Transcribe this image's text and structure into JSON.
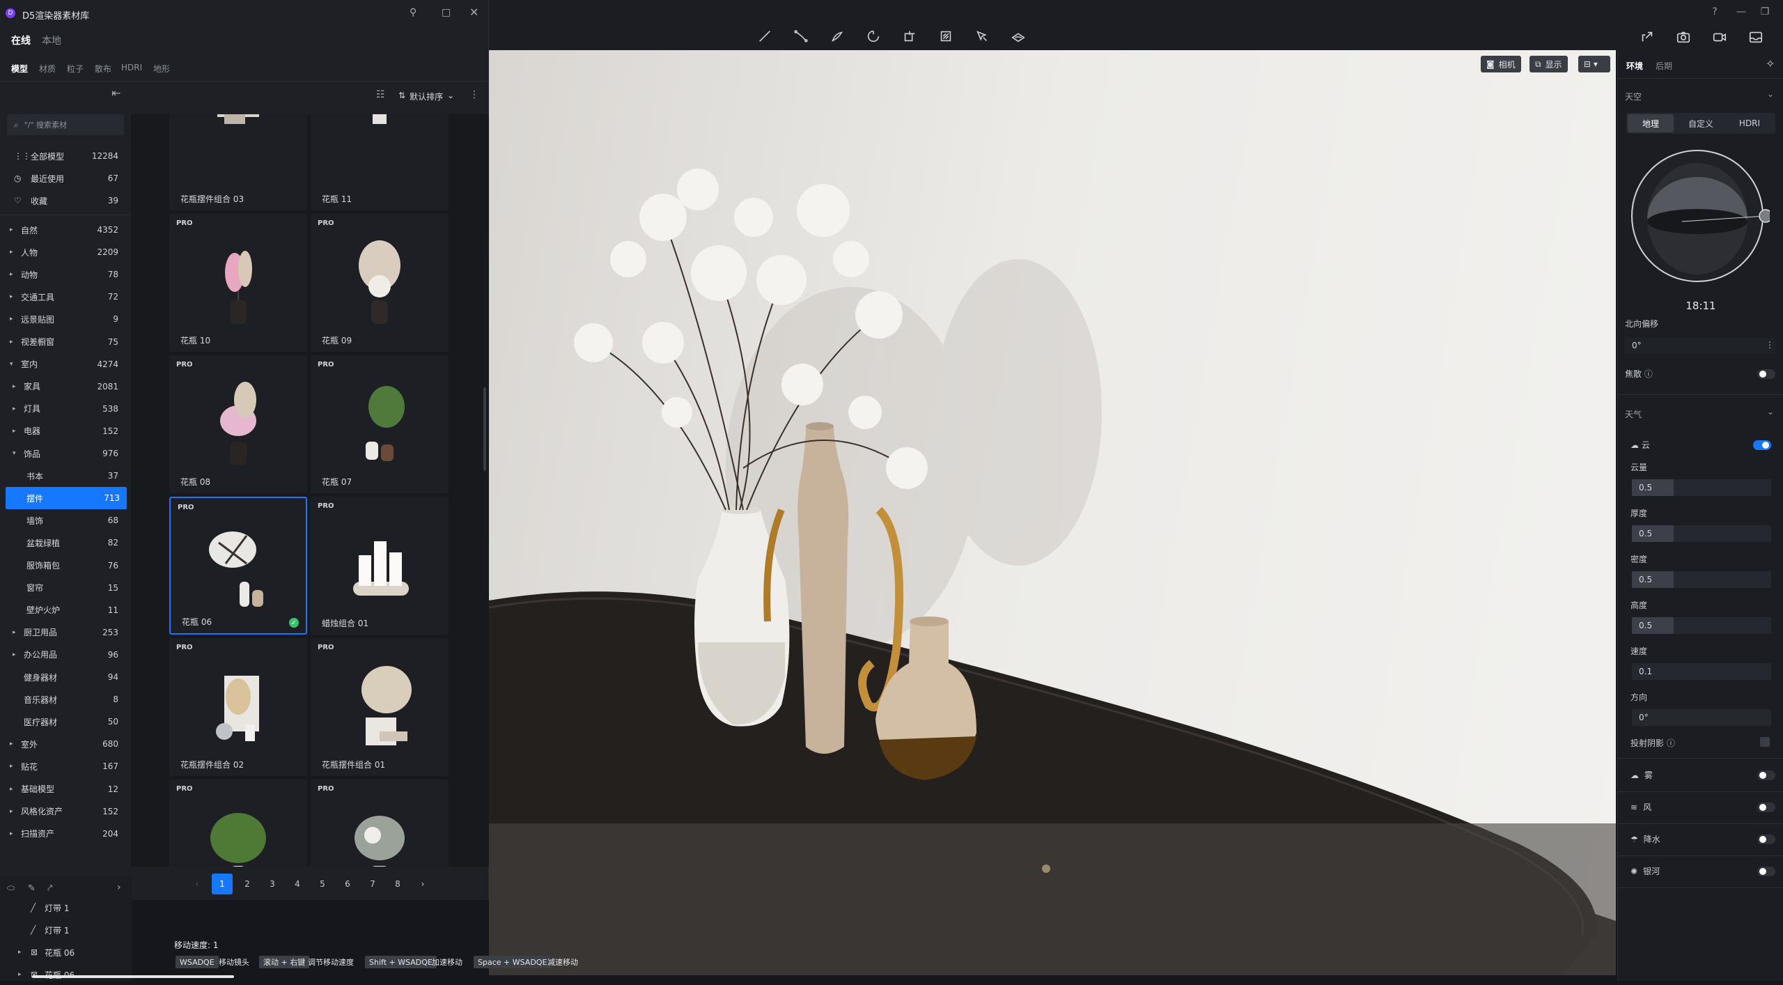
{
  "library": {
    "title": "D5渲染器素材库",
    "source_tabs": [
      "在线",
      "本地"
    ],
    "type_tabs": [
      "模型",
      "材质",
      "粒子",
      "散布",
      "HDRI",
      "地形"
    ],
    "search_placeholder": "\"/\" 搜索素材",
    "sort_label": "默认排序",
    "quick": [
      {
        "label": "全部模型",
        "count": "12284",
        "icon": "grid-icon"
      },
      {
        "label": "最近使用",
        "count": "67",
        "icon": "clock-icon"
      },
      {
        "label": "收藏",
        "count": "39",
        "icon": "heart-icon"
      }
    ],
    "categories": [
      {
        "label": "自然",
        "count": "4352",
        "arrow": "▸",
        "level": 0
      },
      {
        "label": "人物",
        "count": "2209",
        "arrow": "▸",
        "level": 0
      },
      {
        "label": "动物",
        "count": "78",
        "arrow": "▸",
        "level": 0
      },
      {
        "label": "交通工具",
        "count": "72",
        "arrow": "▸",
        "level": 0
      },
      {
        "label": "远景贴图",
        "count": "9",
        "arrow": "▸",
        "level": 0
      },
      {
        "label": "视差橱窗",
        "count": "75",
        "arrow": "▸",
        "level": 0
      },
      {
        "label": "室内",
        "count": "4274",
        "arrow": "▾",
        "level": 0
      },
      {
        "label": "家具",
        "count": "2081",
        "arrow": "▸",
        "level": 1
      },
      {
        "label": "灯具",
        "count": "538",
        "arrow": "▸",
        "level": 1
      },
      {
        "label": "电器",
        "count": "152",
        "arrow": "▸",
        "level": 1
      },
      {
        "label": "饰品",
        "count": "976",
        "arrow": "▾",
        "level": 1
      },
      {
        "label": "书本",
        "count": "37",
        "arrow": "",
        "level": 2
      },
      {
        "label": "摆件",
        "count": "713",
        "arrow": "",
        "level": 2,
        "selected": true
      },
      {
        "label": "墙饰",
        "count": "68",
        "arrow": "",
        "level": 2
      },
      {
        "label": "盆栽绿植",
        "count": "82",
        "arrow": "",
        "level": 2
      },
      {
        "label": "服饰箱包",
        "count": "76",
        "arrow": "",
        "level": 2
      },
      {
        "label": "窗帘",
        "count": "15",
        "arrow": "",
        "level": 2
      },
      {
        "label": "壁炉火炉",
        "count": "11",
        "arrow": "",
        "level": 2
      },
      {
        "label": "厨卫用品",
        "count": "253",
        "arrow": "▸",
        "level": 1
      },
      {
        "label": "办公用品",
        "count": "96",
        "arrow": "▸",
        "level": 1
      },
      {
        "label": "健身器材",
        "count": "94",
        "arrow": "",
        "level": 1
      },
      {
        "label": "音乐器材",
        "count": "8",
        "arrow": "",
        "level": 1
      },
      {
        "label": "医疗器材",
        "count": "50",
        "arrow": "",
        "level": 1
      },
      {
        "label": "室外",
        "count": "680",
        "arrow": "▸",
        "level": 0
      },
      {
        "label": "贴花",
        "count": "167",
        "arrow": "▸",
        "level": 0
      },
      {
        "label": "基础模型",
        "count": "12",
        "arrow": "▸",
        "level": 0
      },
      {
        "label": "风格化资产",
        "count": "152",
        "arrow": "▸",
        "level": 0
      },
      {
        "label": "扫描资产",
        "count": "204",
        "arrow": "▸",
        "level": 0
      }
    ],
    "assets": [
      {
        "name": "花瓶摆件组合 03",
        "pro": "",
        "selected": false
      },
      {
        "name": "花瓶 11",
        "pro": "",
        "selected": false
      },
      {
        "name": "花瓶 10",
        "pro": "PRO",
        "selected": false
      },
      {
        "name": "花瓶 09",
        "pro": "PRO",
        "selected": false
      },
      {
        "name": "花瓶 08",
        "pro": "PRO",
        "selected": false
      },
      {
        "name": "花瓶 07",
        "pro": "PRO",
        "selected": false
      },
      {
        "name": "花瓶 06",
        "pro": "PRO",
        "selected": true
      },
      {
        "name": "蜡烛组合 01",
        "pro": "PRO",
        "selected": false
      },
      {
        "name": "花瓶摆件组合 02",
        "pro": "PRO",
        "selected": false
      },
      {
        "name": "花瓶摆件组合 01",
        "pro": "PRO",
        "selected": false
      },
      {
        "name": "",
        "pro": "PRO",
        "selected": false
      },
      {
        "name": "",
        "pro": "PRO",
        "selected": false
      }
    ],
    "pagination": {
      "prev": "‹",
      "next": "›",
      "pages": [
        "1",
        "2",
        "3",
        "4",
        "5",
        "6",
        "7",
        "8"
      ],
      "current": "1"
    }
  },
  "scene_tree": [
    {
      "label": "灯带 1",
      "icon": "line-icon"
    },
    {
      "label": "灯带 1",
      "icon": "line-icon"
    },
    {
      "label": "花瓶 06",
      "icon": "model-icon"
    },
    {
      "label": "花瓶 06",
      "icon": "model-icon"
    }
  ],
  "viewport": {
    "buttons": [
      "相机",
      "显示"
    ],
    "move_speed": "移动速度: 1",
    "hints": [
      {
        "key": "WSADQE",
        "desc": "移动镜头"
      },
      {
        "key": "滚动 + 右键",
        "desc": "调节移动速度"
      },
      {
        "key": "Shift + WSADQE",
        "desc": "加速移动"
      },
      {
        "key": "Space + WSADQE",
        "desc": "减速移动"
      }
    ]
  },
  "right_panel": {
    "tabs": [
      "环境",
      "后期"
    ],
    "sky_section": "天空",
    "sky_modes": [
      "地理",
      "自定义",
      "HDRI"
    ],
    "time": "18:11",
    "north_offset_label": "北向偏移",
    "north_offset_value": "0°",
    "focus_label": "焦散",
    "weather_section": "天气",
    "cloud_label": "云",
    "params": [
      {
        "label": "云量",
        "value": "0.5",
        "fraction": 0.3
      },
      {
        "label": "厚度",
        "value": "0.5",
        "fraction": 0.3
      },
      {
        "label": "密度",
        "value": "0.5",
        "fraction": 0.3
      },
      {
        "label": "高度",
        "value": "0.5",
        "fraction": 0.3
      },
      {
        "label": "速度",
        "value": "0.1",
        "fraction": 0
      },
      {
        "label": "方向",
        "value": "0°",
        "fraction": 0
      }
    ],
    "shadow_label": "投射阴影",
    "effects": [
      {
        "label": "雾",
        "on": false
      },
      {
        "label": "风",
        "on": false
      },
      {
        "label": "降水",
        "on": false
      },
      {
        "label": "银河",
        "on": false
      }
    ]
  },
  "colors": {
    "accent": "#1677ff",
    "panel": "#1e2026",
    "bg": "#15171c"
  }
}
